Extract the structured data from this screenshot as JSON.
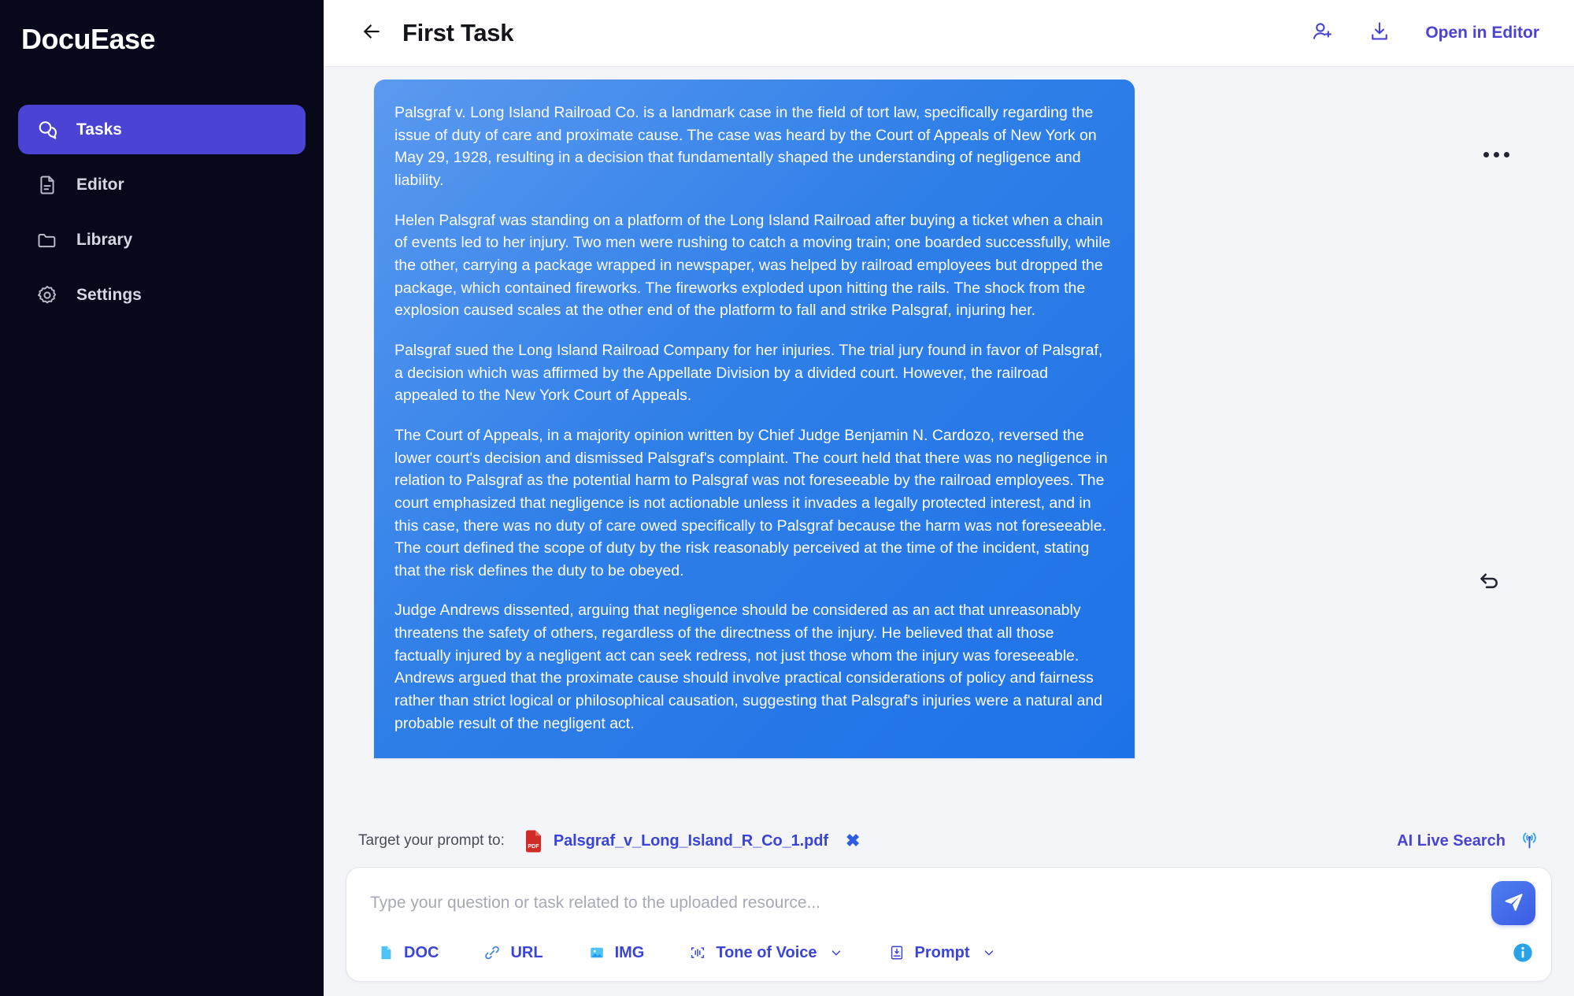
{
  "brand": {
    "name": "DocuEase"
  },
  "sidebar": {
    "items": [
      {
        "label": "Tasks",
        "icon": "chat-bubbles-icon",
        "active": true
      },
      {
        "label": "Editor",
        "icon": "document-icon",
        "active": false
      },
      {
        "label": "Library",
        "icon": "folder-icon",
        "active": false
      },
      {
        "label": "Settings",
        "icon": "gear-icon",
        "active": false
      }
    ]
  },
  "topbar": {
    "back_icon": "arrow-left-icon",
    "title": "First Task",
    "invite_icon": "add-user-icon",
    "download_icon": "download-icon",
    "open_in_editor": "Open in Editor"
  },
  "message": {
    "more_icon": "more-horizontal-icon",
    "undo_icon": "undo-arrow-icon",
    "paragraphs": [
      "Palsgraf v. Long Island Railroad Co. is a landmark case in the field of tort law, specifically regarding the issue of duty of care and proximate cause. The case was heard by the Court of Appeals of New York on May 29, 1928, resulting in a decision that fundamentally shaped the understanding of negligence and liability.",
      "Helen Palsgraf was standing on a platform of the Long Island Railroad after buying a ticket when a chain of events led to her injury. Two men were rushing to catch a moving train; one boarded successfully, while the other, carrying a package wrapped in newspaper, was helped by railroad employees but dropped the package, which contained fireworks. The fireworks exploded upon hitting the rails. The shock from the explosion caused scales at the other end of the platform to fall and strike Palsgraf, injuring her.",
      "Palsgraf sued the Long Island Railroad Company for her injuries. The trial jury found in favor of Palsgraf, a decision which was affirmed by the Appellate Division by a divided court. However, the railroad appealed to the New York Court of Appeals.",
      "The Court of Appeals, in a majority opinion written by Chief Judge Benjamin N. Cardozo, reversed the lower court's decision and dismissed Palsgraf's complaint. The court held that there was no negligence in relation to Palsgraf as the potential harm to Palsgraf was not foreseeable by the railroad employees. The court emphasized that negligence is not actionable unless it invades a legally protected interest, and in this case, there was no duty of care owed specifically to Palsgraf because the harm was not foreseeable. The court defined the scope of duty by the risk reasonably perceived at the time of the incident, stating that the risk defines the duty to be obeyed.",
      "Judge Andrews dissented, arguing that negligence should be considered as an act that unreasonably threatens the safety of others, regardless of the directness of the injury. He believed that all those factually injured by a negligent act can seek redress, not just those whom the injury was foreseeable. Andrews argued that the proximate cause should involve practical considerations of policy and fairness rather than strict logical or philosophical causation, suggesting that Palsgraf's injuries were a natural and probable result of the negligent act."
    ]
  },
  "composer": {
    "target_label": "Target your prompt to:",
    "attachment": {
      "icon": "pdf-file-icon",
      "name": "Palsgraf_v_Long_Island_R_Co_1.pdf",
      "remove_icon": "close-x-icon",
      "remove_label": "✖"
    },
    "live_search": {
      "label": "AI Live Search",
      "icon": "broadcast-antenna-icon"
    },
    "input_placeholder": "Type your question or task related to the uploaded resource...",
    "input_value": "",
    "send_icon": "send-paper-plane-icon",
    "tools": [
      {
        "label": "DOC",
        "icon": "doc-file-icon",
        "caret": false
      },
      {
        "label": "URL",
        "icon": "link-icon",
        "caret": false
      },
      {
        "label": "IMG",
        "icon": "image-icon",
        "caret": false
      },
      {
        "label": "Tone of Voice",
        "icon": "tone-of-voice-icon",
        "caret": true
      },
      {
        "label": "Prompt",
        "icon": "prompt-book-icon",
        "caret": true
      }
    ],
    "info_icon": "info-circle-icon"
  },
  "colors": {
    "sidebar_bg": "#07081a",
    "accent": "#4a43d4",
    "bubble_blue": "#2f7fe8",
    "page_bg": "#f4f5f8",
    "pdf_red": "#cf2b27",
    "info_blue": "#29a3e8"
  }
}
